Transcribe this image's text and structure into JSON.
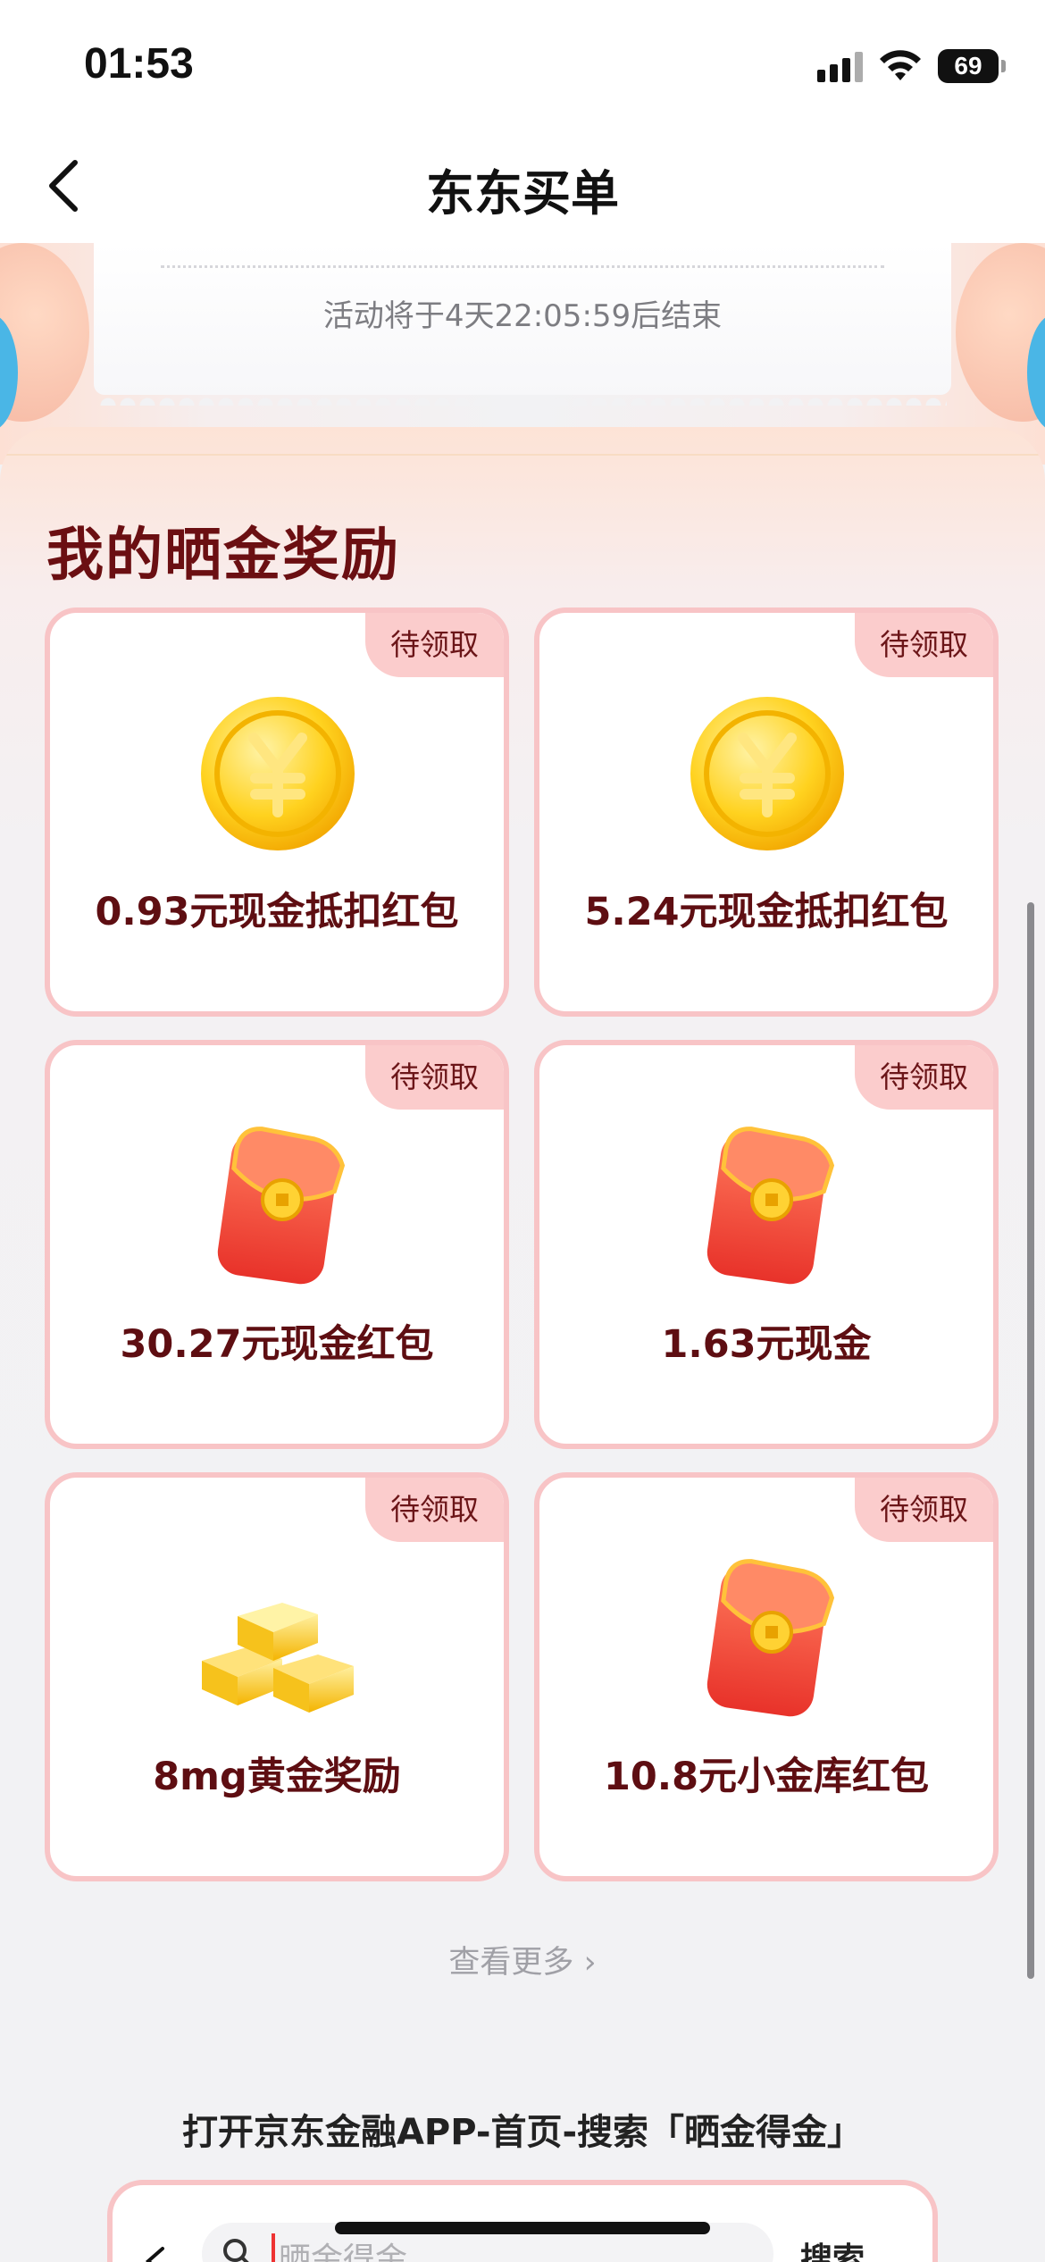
{
  "status_bar": {
    "time": "01:53",
    "battery": "69"
  },
  "nav": {
    "title": "东东买单"
  },
  "banner": {
    "countdown": "活动将于4天22:05:59后结束"
  },
  "rewards": {
    "title": "我的晒金奖励",
    "cards": [
      {
        "badge": "待领取",
        "label": "0.93元现金抵扣红包",
        "icon": "gold-coin-icon"
      },
      {
        "badge": "待领取",
        "label": "5.24元现金抵扣红包",
        "icon": "gold-coin-icon"
      },
      {
        "badge": "待领取",
        "label": "30.27元现金红包",
        "icon": "red-envelope-icon"
      },
      {
        "badge": "待领取",
        "label": "1.63元现金",
        "icon": "red-envelope-icon"
      },
      {
        "badge": "待领取",
        "label": "8mg黄金奖励",
        "icon": "gold-bars-icon"
      },
      {
        "badge": "待领取",
        "label": "10.8元小金库红包",
        "icon": "red-envelope-icon"
      }
    ],
    "view_more": "查看更多"
  },
  "instruction": "打开京东金融APP-首页-搜索「晒金得金」",
  "search_preview": {
    "placeholder": "晒金得金",
    "button": "搜索"
  },
  "colors": {
    "accent": "#6b0f12",
    "card_border": "#f8c4c6",
    "badge_bg": "#fbcccc"
  }
}
